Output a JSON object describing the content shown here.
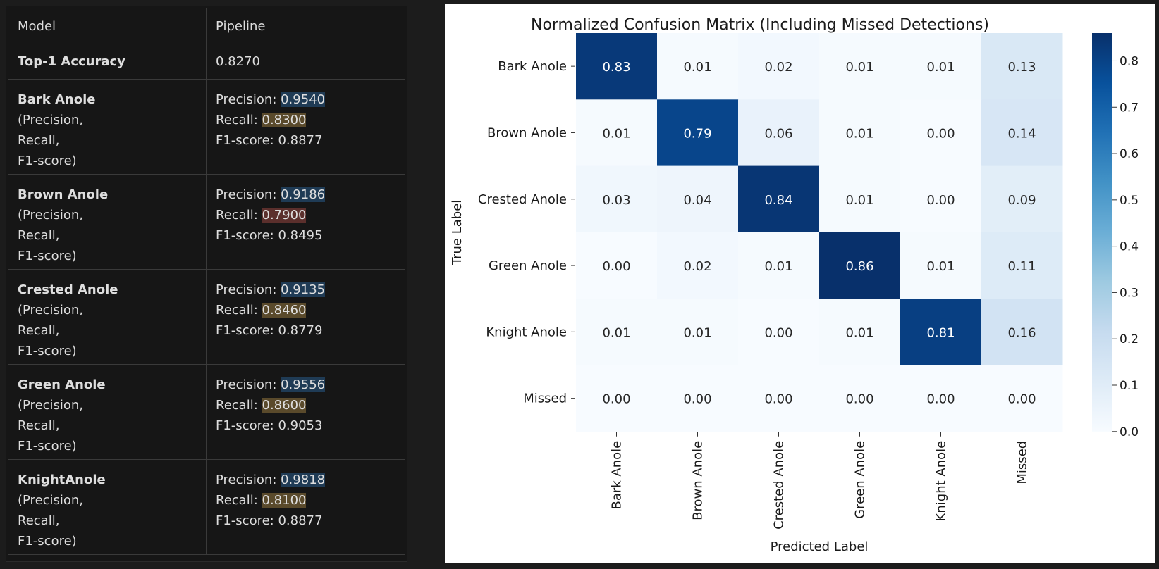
{
  "table": {
    "header": {
      "model": "Model",
      "pipeline": "Pipeline"
    },
    "accuracy": {
      "label": "Top-1 Accuracy",
      "value": "0.8270"
    },
    "metric_labels": [
      "(Precision,",
      "Recall,",
      "F1-score)"
    ],
    "rows": [
      {
        "name": "Bark Anole",
        "precision_label": "Precision: ",
        "precision": "0.9540",
        "precision_hl": "blue",
        "recall_label": "Recall: ",
        "recall": "0.8300",
        "recall_hl": "yellow",
        "f1": "F1-score: 0.8877"
      },
      {
        "name": "Brown Anole",
        "precision_label": "Precision: ",
        "precision": "0.9186",
        "precision_hl": "blue",
        "recall_label": "Recall: ",
        "recall": "0.7900",
        "recall_hl": "red",
        "f1": "F1-score: 0.8495"
      },
      {
        "name": "Crested Anole",
        "precision_label": "Precision: ",
        "precision": "0.9135",
        "precision_hl": "blue",
        "recall_label": "Recall: ",
        "recall": "0.8460",
        "recall_hl": "yellow",
        "f1": "F1-score: 0.8779"
      },
      {
        "name": "Green Anole",
        "precision_label": "Precision: ",
        "precision": "0.9556",
        "precision_hl": "blue",
        "recall_label": "Recall: ",
        "recall": "0.8600",
        "recall_hl": "yellow",
        "f1": "F1-score: 0.9053"
      },
      {
        "name": "KnightAnole",
        "precision_label": "Precision: ",
        "precision": "0.9818",
        "precision_hl": "blue",
        "recall_label": "Recall: ",
        "recall": "0.8100",
        "recall_hl": "yellow",
        "f1": "F1-score: 0.8877"
      }
    ]
  },
  "chart_data": {
    "type": "heatmap",
    "title": "Normalized Confusion Matrix (Including Missed Detections)",
    "xlabel": "Predicted Label",
    "ylabel": "True Label",
    "row_labels": [
      "Bark Anole",
      "Brown Anole",
      "Crested Anole",
      "Green Anole",
      "Knight Anole",
      "Missed"
    ],
    "col_labels": [
      "Bark Anole",
      "Brown Anole",
      "Crested Anole",
      "Green Anole",
      "Knight Anole",
      "Missed"
    ],
    "values": [
      [
        0.83,
        0.01,
        0.02,
        0.01,
        0.01,
        0.13
      ],
      [
        0.01,
        0.79,
        0.06,
        0.01,
        0.0,
        0.14
      ],
      [
        0.03,
        0.04,
        0.84,
        0.01,
        0.0,
        0.09
      ],
      [
        0.0,
        0.02,
        0.01,
        0.86,
        0.01,
        0.11
      ],
      [
        0.01,
        0.01,
        0.0,
        0.01,
        0.81,
        0.16
      ],
      [
        0.0,
        0.0,
        0.0,
        0.0,
        0.0,
        0.0
      ]
    ],
    "colormap": "Blues",
    "colorbar": {
      "range": [
        0.0,
        0.86
      ],
      "ticks": [
        "0.0",
        "0.1",
        "0.2",
        "0.3",
        "0.4",
        "0.5",
        "0.6",
        "0.7",
        "0.8"
      ]
    }
  }
}
